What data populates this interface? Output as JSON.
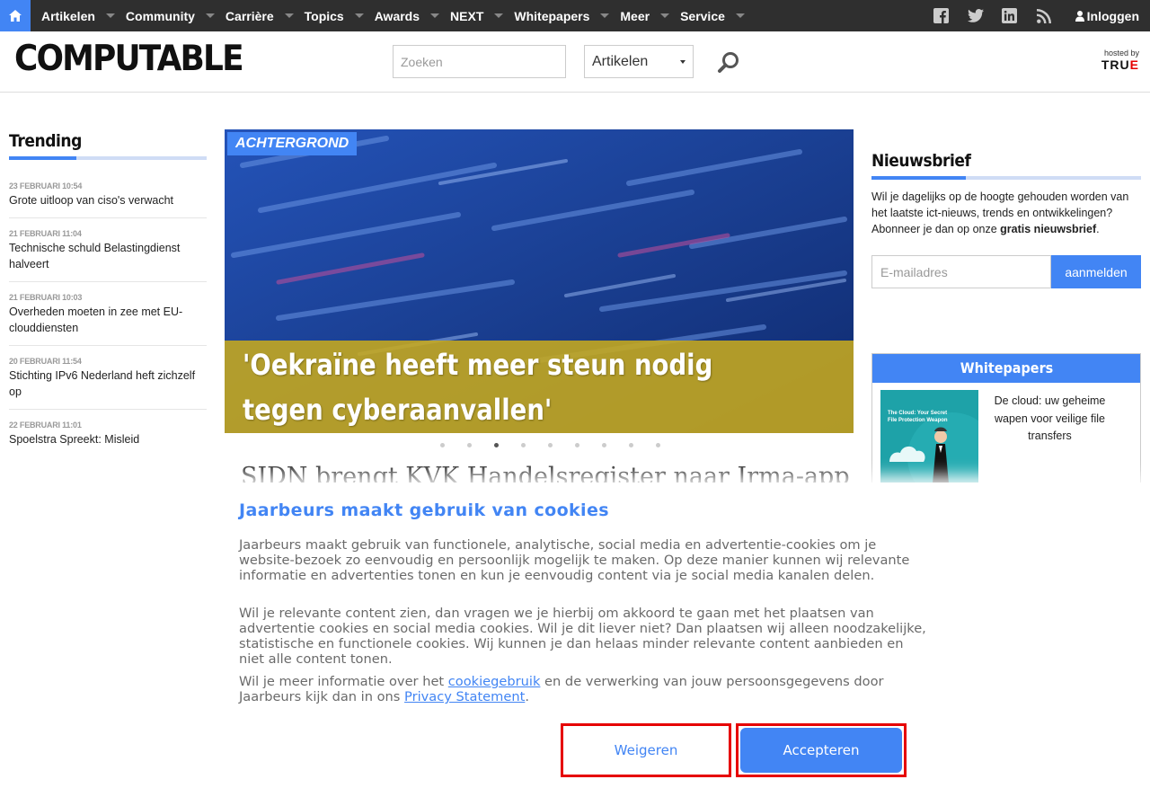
{
  "nav": {
    "items": [
      "Artikelen",
      "Community",
      "Carrière",
      "Topics",
      "Awards",
      "NEXT",
      "Whitepapers",
      "Meer",
      "Service"
    ],
    "login": "Inloggen",
    "social": [
      "facebook-icon",
      "twitter-icon",
      "linkedin-icon",
      "rss-icon"
    ]
  },
  "header": {
    "logo": "COMPUTABLE",
    "search_placeholder": "Zoeken",
    "search_scope": "Artikelen",
    "hosted_by": "hosted by",
    "host_logo": "TRUE"
  },
  "trending": {
    "title": "Trending",
    "items": [
      {
        "date": "23 FEBRUARI 10:54",
        "title": "Grote uitloop van ciso's verwacht"
      },
      {
        "date": "21 FEBRUARI 11:04",
        "title": "Technische schuld Belastingdienst halveert"
      },
      {
        "date": "21 FEBRUARI 10:03",
        "title": "Overheden moeten in zee met EU-clouddiensten"
      },
      {
        "date": "20 FEBRUARI 11:54",
        "title": "Stichting IPv6 Nederland heft zichzelf op"
      },
      {
        "date": "22 FEBRUARI 11:01",
        "title": "Spoelstra Spreekt: Misleid"
      }
    ]
  },
  "hero": {
    "badge": "ACHTERGROND",
    "title": "'Oekraïne heeft meer steun nodig tegen cyberaanvallen'",
    "slide_count": 9,
    "active_slide": 3
  },
  "article_title": "SIDN brengt KVK Handelsregister naar Irma-app",
  "newsletter": {
    "title": "Nieuwsbrief",
    "text_before": "Wil je dagelijks op de hoogte gehouden worden van het laatste ict-nieuws, trends en ontwikkelingen? Abonneer je dan op onze ",
    "text_bold": "gratis nieuwsbrief",
    "text_after": ".",
    "email_placeholder": "E-mailadres",
    "button": "aanmelden"
  },
  "whitepapers": {
    "title": "Whitepapers",
    "item_title": "De cloud: uw geheime wapen voor veilige file transfers",
    "thumb_text": "The Cloud: Your Secret File Protection Weapon"
  },
  "cookie": {
    "title": "Jaarbeurs maakt gebruik van cookies",
    "p1": "Jaarbeurs maakt gebruik van functionele, analytische, social media en advertentie-cookies om je website-bezoek zo eenvoudig en persoonlijk mogelijk te maken. Op deze manier kunnen wij relevante informatie en advertenties tonen en kun je eenvoudig content via je social media kanalen delen.",
    "p2": "Wil je relevante content zien, dan vragen we je hierbij om akkoord te gaan met het plaatsen van advertentie cookies en social media cookies. Wil je dit liever niet? Dan plaatsen wij alleen noodzakelijke, statistische en functionele cookies. Wij kunnen je dan helaas minder relevante content aanbieden en niet alle content tonen.",
    "p3_before": "Wil je meer informatie over het ",
    "p3_link1": "cookiegebruik",
    "p3_middle": " en de verwerking van jouw persoonsgegevens door Jaarbeurs kijk dan in ons ",
    "p3_link2": "Privacy Statement",
    "p3_after": ".",
    "refuse": "Weigeren",
    "accept": "Accepteren"
  },
  "colors": {
    "accent": "#4285f4",
    "nav_bg": "#2f2f2f",
    "highlight": "#e60000"
  }
}
